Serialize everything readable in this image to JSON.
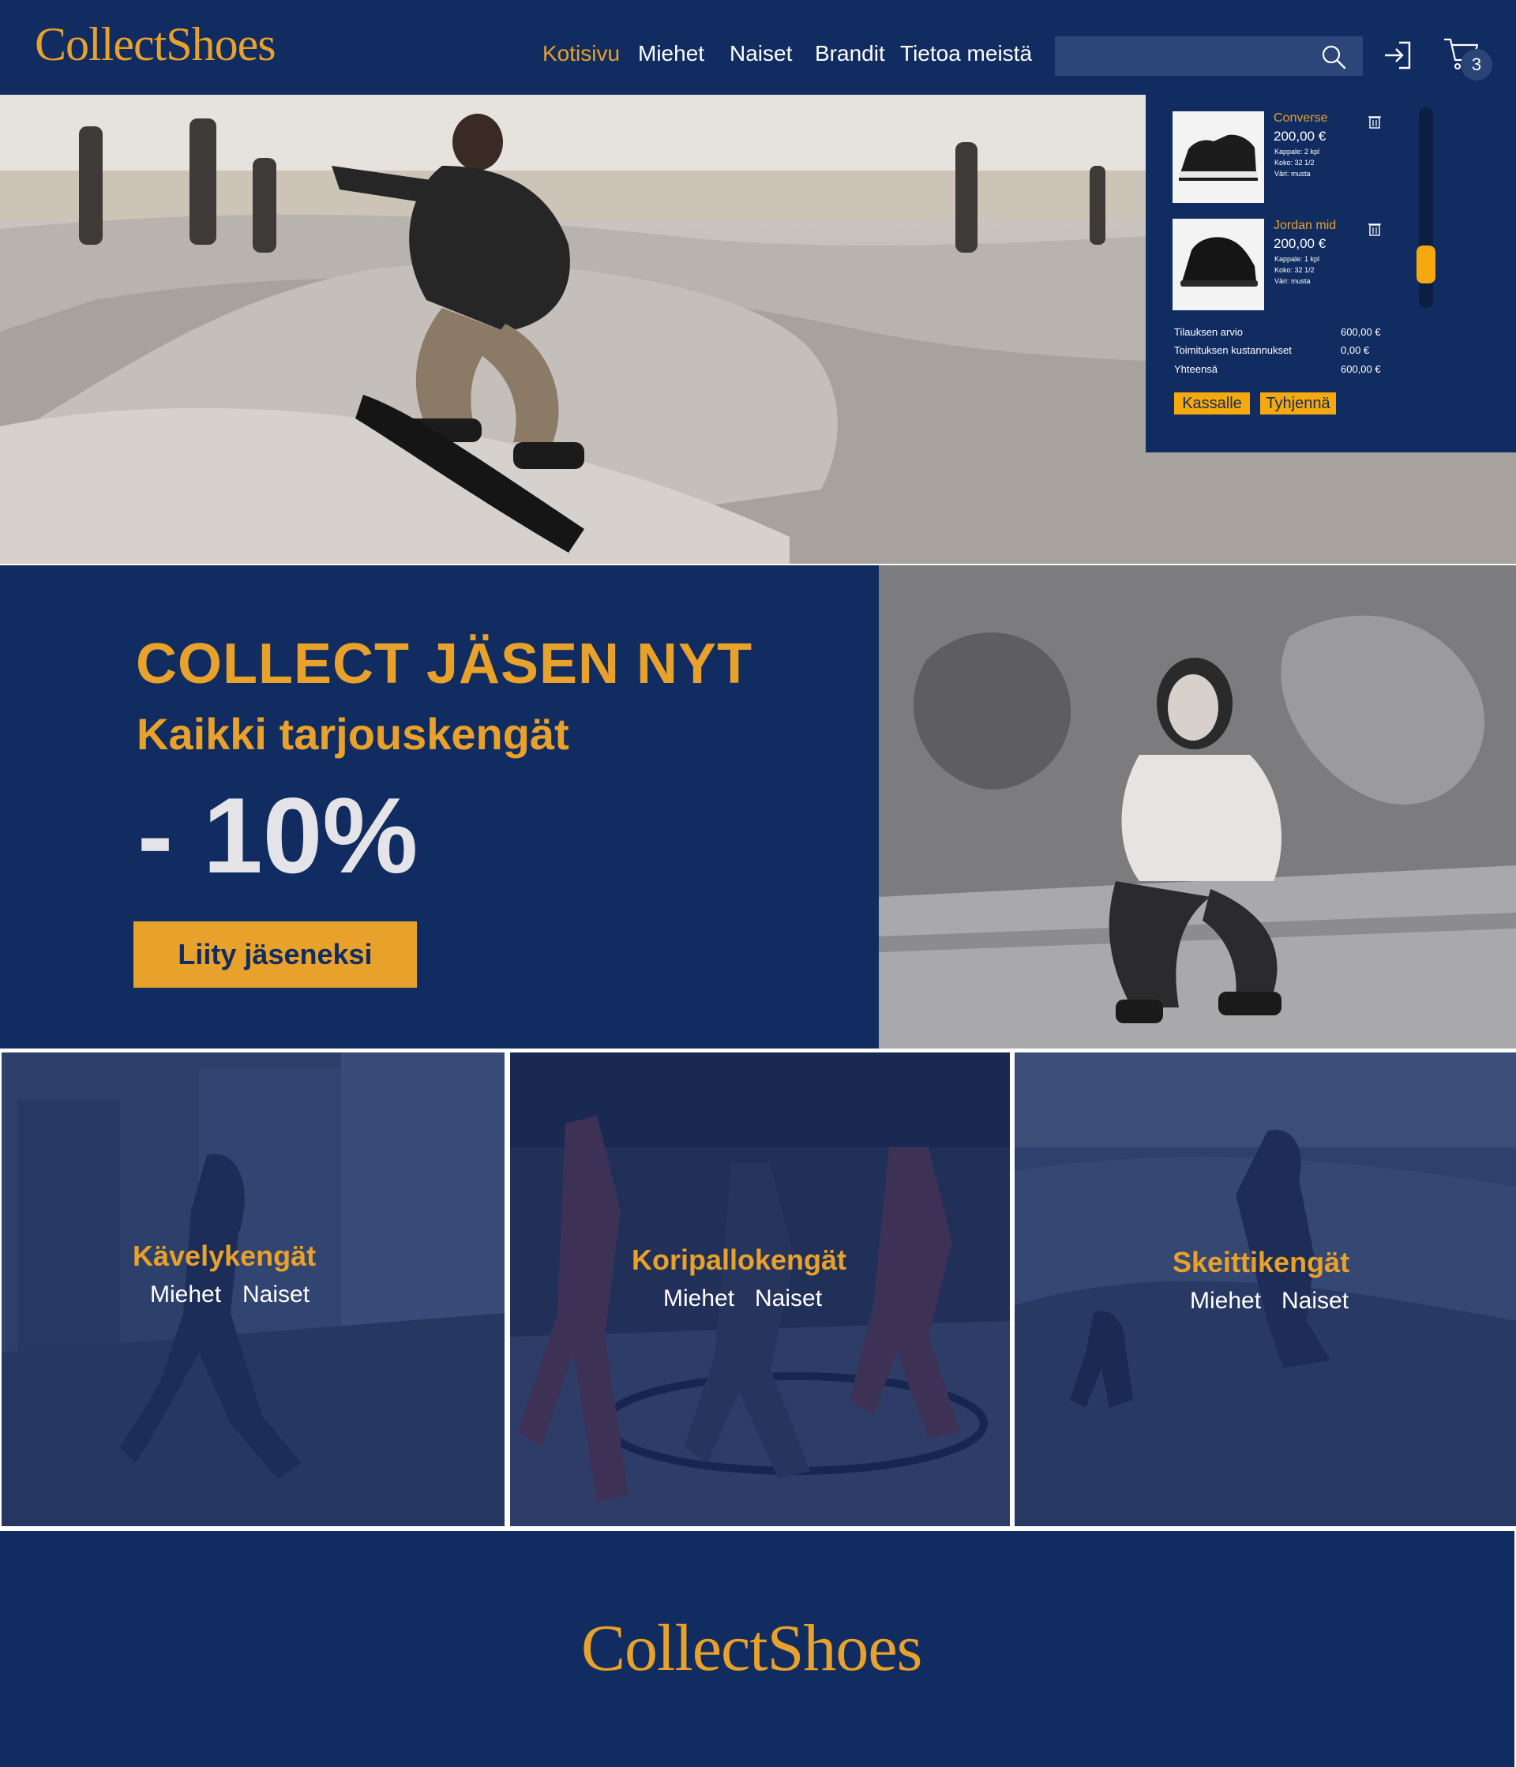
{
  "brand": {
    "name": "CollectShoes"
  },
  "colors": {
    "navy": "#112c60",
    "accent": "#e8a12a",
    "button": "#f5a90e",
    "text_light": "#ffffff"
  },
  "nav": {
    "items": [
      {
        "label": "Kotisivu",
        "active": true
      },
      {
        "label": "Miehet",
        "active": false
      },
      {
        "label": "Naiset",
        "active": false
      },
      {
        "label": "Brandit",
        "active": false
      },
      {
        "label": "Tietoa meistä",
        "active": false
      }
    ]
  },
  "search": {
    "placeholder": "",
    "icon": "search-icon"
  },
  "header_icons": {
    "login": "login-icon",
    "cart": "cart-icon",
    "cart_count": "3"
  },
  "cart": {
    "items": [
      {
        "name": "Converse",
        "price": "200,00 €",
        "quantity": "Kappale: 2 kpl",
        "size": "Koko: 32 1/2",
        "color": "Väri: musta"
      },
      {
        "name": "Jordan mid",
        "price": "200,00 €",
        "quantity": "Kappale: 1 kpl",
        "size": "Koko: 32 1/2",
        "color": "Väri: musta"
      }
    ],
    "summary": [
      {
        "label": "Tilauksen arvio",
        "value": "600,00 €"
      },
      {
        "label": "Toimituksen kustannukset",
        "value": "0,00 €"
      },
      {
        "label": "Yhteensä",
        "value": "600,00 €"
      }
    ],
    "checkout_label": "Kassalle",
    "clear_label": "Tyhjennä",
    "scroll_position": 0.85
  },
  "promo": {
    "headline": "COLLECT JÄSEN NYT",
    "subheadline": "Kaikki tarjouskengät",
    "discount": "- 10%",
    "cta_label": "Liity jäseneksi"
  },
  "categories": [
    {
      "title": "Kävelykengät",
      "links": [
        "Miehet",
        "Naiset"
      ]
    },
    {
      "title": "Koripallokengät",
      "links": [
        "Miehet",
        "Naiset"
      ]
    },
    {
      "title": "Skeittikengät",
      "links": [
        "Miehet",
        "Naiset"
      ]
    }
  ],
  "footer": {
    "logo": "CollectShoes"
  }
}
